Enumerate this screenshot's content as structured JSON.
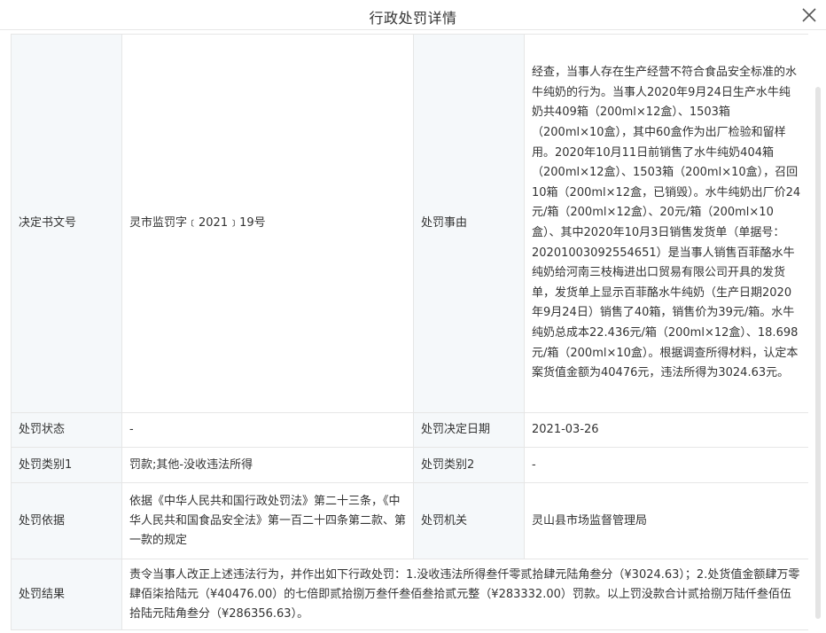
{
  "modal": {
    "title": "行政处罚详情"
  },
  "rows": {
    "decision_no": {
      "label": "决定书文号",
      "value": "灵市监罚字﹝2021﹞19号"
    },
    "reason": {
      "label": "处罚事由",
      "value": "经查，当事人存在生产经营不符合食品安全标准的水牛纯奶的行为。当事人2020年9月24日生产水牛纯奶共409箱（200ml×12盒）、1503箱（200ml×10盒），其中60盒作为出厂检验和留样用。2020年10月11日前销售了水牛纯奶404箱（200ml×12盒）、1503箱（200ml×10盒），召回10箱（200ml×12盒，已销毁）。水牛纯奶出厂价24元/箱（200ml×12盒）、20元/箱（200ml×10盒）、其中2020年10月3日销售发货单（单据号：20201003092554651）是当事人销售百菲酪水牛纯奶给河南三枝梅进出口贸易有限公司开具的发货单，发货单上显示百菲酪水牛纯奶（生产日期2020年9月24日）销售了40箱，销售价为39元/箱。水牛纯奶总成本22.436元/箱（200ml×12盒）、18.698元/箱（200ml×10盒）。根据调查所得材料，认定本案货值金额为40476元，违法所得为3024.63元。"
    },
    "status": {
      "label": "处罚状态",
      "value": "-"
    },
    "decision_date": {
      "label": "处罚决定日期",
      "value": "2021-03-26"
    },
    "category1": {
      "label": "处罚类别1",
      "value": "罚款;其他-没收违法所得"
    },
    "category2": {
      "label": "处罚类别2",
      "value": "-"
    },
    "basis": {
      "label": "处罚依据",
      "value": "依据《中华人民共和国行政处罚法》第二十三条，《中华人民共和国食品安全法》第一百二十四条第二款、第一款的规定"
    },
    "authority": {
      "label": "处罚机关",
      "value": "灵山县市场监督管理局"
    },
    "result": {
      "label": "处罚结果",
      "value": "责令当事人改正上述违法行为，并作出如下行政处罚：1.没收违法所得叁仟零贰拾肆元陆角叁分（¥3024.63）；2.处货值金额肆万零肆佰柒拾陆元（¥40476.00）的七倍即贰拾捌万叁仟叁佰叁拾贰元整（¥283332.00）罚款。以上罚没款合计贰拾捌万陆仟叁佰伍拾陆元陆角叁分（¥286356.63）。"
    }
  },
  "icons": {
    "close": "close-icon"
  }
}
